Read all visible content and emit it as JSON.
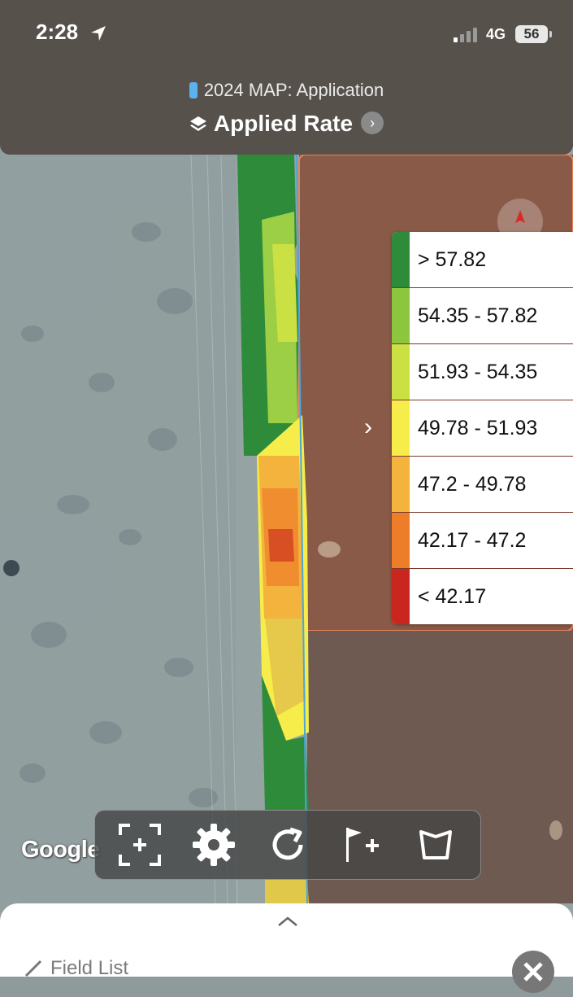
{
  "status_bar": {
    "time": "2:28",
    "network": "4G",
    "battery": "56"
  },
  "header": {
    "subtitle": "2024 MAP: Application",
    "title": "Applied Rate"
  },
  "legend": {
    "items": [
      {
        "label": "> 57.82",
        "color": "#2e8b3a"
      },
      {
        "label": "54.35 - 57.82",
        "color": "#8cc63f"
      },
      {
        "label": "51.93 - 54.35",
        "color": "#cbe043"
      },
      {
        "label": "49.78 - 51.93",
        "color": "#f7ed4a"
      },
      {
        "label": "47.2 - 49.78",
        "color": "#f4b33c"
      },
      {
        "label": "42.17 - 47.2",
        "color": "#ee7d2a"
      },
      {
        "label": "< 42.17",
        "color": "#c8261e"
      }
    ]
  },
  "map": {
    "attribution": "Google"
  },
  "toolbar": {
    "icons": [
      "zoom-extent-icon",
      "gear-icon",
      "refresh-icon",
      "add-flag-icon",
      "boundary-icon"
    ]
  },
  "sheet": {
    "field_list_label": "Field List"
  }
}
